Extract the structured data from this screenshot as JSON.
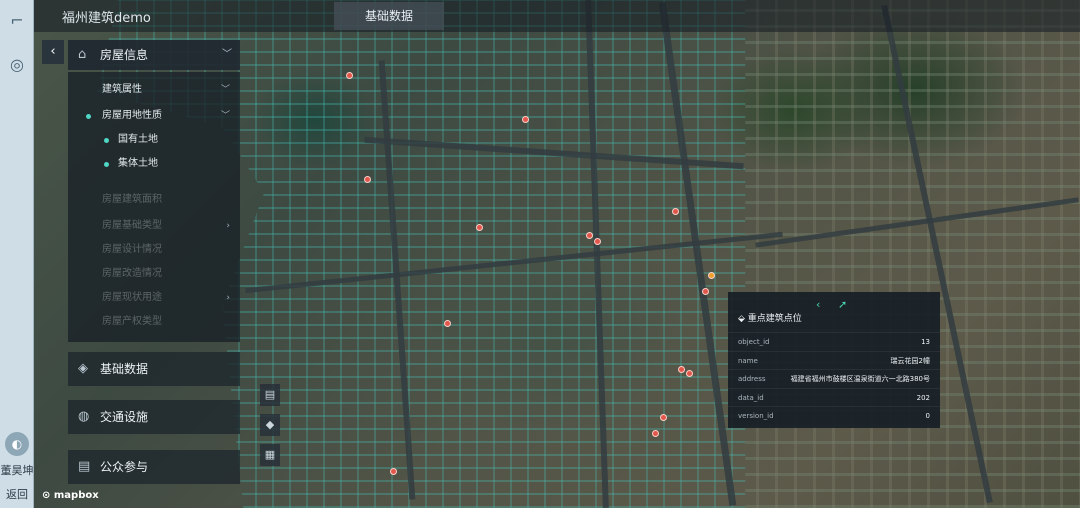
{
  "rail": {
    "user": "董昊坤",
    "back": "返回"
  },
  "topbar": {
    "app_title": "福州建筑demo",
    "tab_base": "基础数据"
  },
  "panel": {
    "header": "房屋信息",
    "rows": [
      {
        "label": "建筑属性",
        "active": true
      },
      {
        "label": "房屋用地性质",
        "active": true
      },
      {
        "label": "国有土地",
        "active": true
      },
      {
        "label": "集体土地",
        "active": true
      },
      {
        "label": "房屋建筑面积",
        "active": false
      },
      {
        "label": "房屋基础类型",
        "active": false
      },
      {
        "label": "房屋设计情况",
        "active": false
      },
      {
        "label": "房屋改造情况",
        "active": false
      },
      {
        "label": "房屋现状用途",
        "active": false
      },
      {
        "label": "房屋产权类型",
        "active": false
      }
    ],
    "sections": [
      "基础数据",
      "交通设施",
      "公众参与"
    ]
  },
  "popup": {
    "title": "重点建筑点位",
    "rows": [
      {
        "k": "object_id",
        "v": "13"
      },
      {
        "k": "name",
        "v": "瑞云花园2幢"
      },
      {
        "k": "address",
        "v": "福建省福州市鼓楼区温泉街道六一北路380号"
      },
      {
        "k": "data_id",
        "v": "202"
      },
      {
        "k": "version_id",
        "v": "0"
      }
    ]
  },
  "map_attribution": "mapbox",
  "icons": [
    "collapse-icon",
    "house-icon",
    "chevron-down-icon",
    "layer-icon",
    "traffic-icon",
    "people-icon",
    "list-icon",
    "avatar-icon",
    "back-icon",
    "prev-icon",
    "next-icon"
  ],
  "colors": {
    "building_fill": "#3fbfb5",
    "poi": "#e2574c",
    "popup_accent": "#49d3b3"
  }
}
